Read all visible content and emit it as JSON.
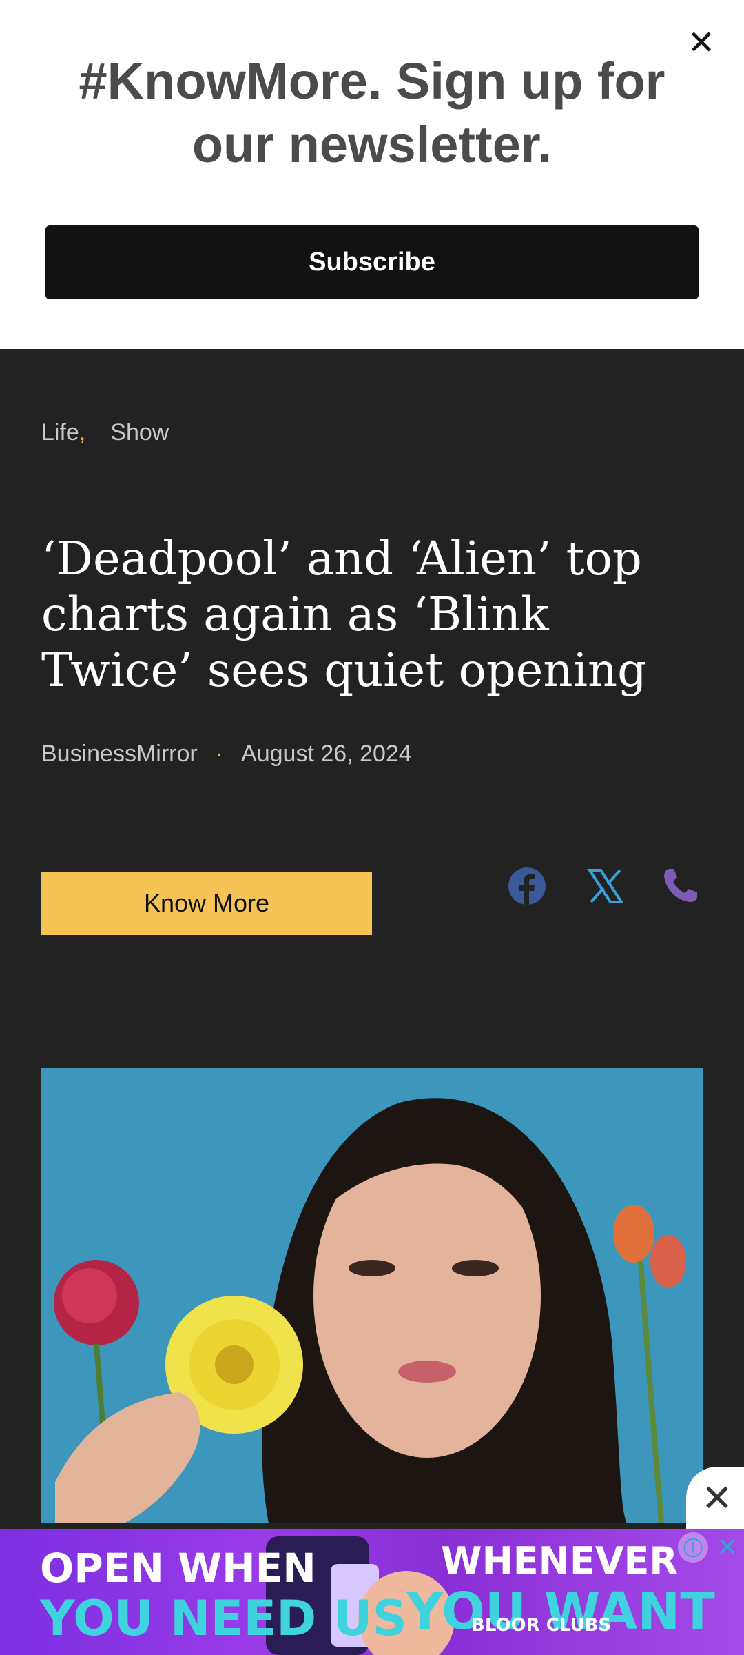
{
  "banner": {
    "close_icon": "✕",
    "title": "#KnowMore. Sign up for our newsletter.",
    "subscribe_label": "Subscribe"
  },
  "article": {
    "categories": [
      "Life",
      "Show"
    ],
    "category_separator": ",",
    "headline": "‘Deadpool’ and ‘Alien’ top charts again as ‘Blink Twice’ sees quiet opening",
    "source": "BusinessMirror",
    "byline_dot": "·",
    "date": "August 26, 2024",
    "know_more_label": "Know More",
    "share_icons": [
      "facebook-icon",
      "x-icon",
      "phone-icon"
    ],
    "photo_icon": "woman-with-yellow-flower-photo"
  },
  "ad": {
    "close_icon": "✕",
    "info_icon": "ⓘ",
    "x_icon": "✕",
    "left_line1": "OPEN WHEN",
    "left_line2": "YOU NEED US",
    "right_line1": "WHENEVER",
    "right_line2": "YOU WANT",
    "right_line3": "BLOOR CLUBS"
  },
  "colors": {
    "accent": "#f6c355",
    "background": "#222223",
    "facebook": "#3b5998",
    "x": "#3aa0d8",
    "phone": "#7e5bb5"
  }
}
